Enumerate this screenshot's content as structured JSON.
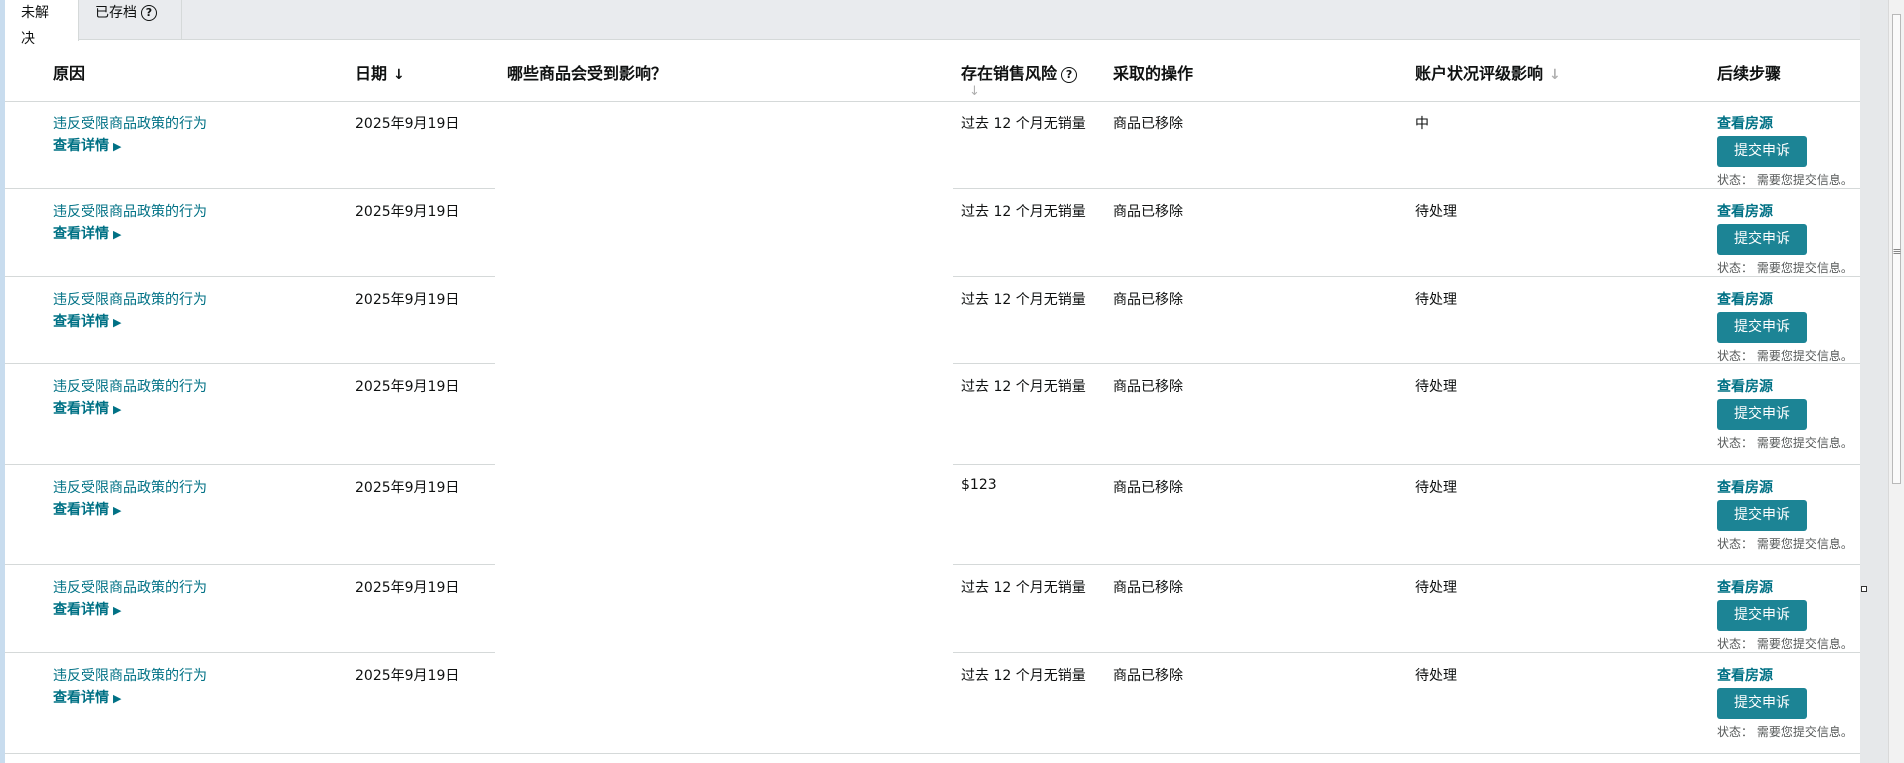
{
  "tabs": {
    "unresolved": "未解决",
    "archived": "已存档"
  },
  "columns": {
    "reason": "原因",
    "date": "日期",
    "affected": "哪些商品会受到影响？",
    "risk": "存在销售风险",
    "action": "采取的操作",
    "impact": "账户状况评级影响",
    "next": "后续步骤"
  },
  "icons": {
    "sort_down": "↓",
    "triangle": "▶",
    "help": "?"
  },
  "labels": {
    "view_details": "查看详情",
    "view_source": "查看房源",
    "submit_appeal": "提交申诉",
    "status": "状态： 需要您提交信息。"
  },
  "rows": [
    {
      "reason": "违反受限商品政策的行为",
      "date": "2025年9月19日",
      "risk": "过去 12 个月无销量",
      "action": "商品已移除",
      "impact": "中"
    },
    {
      "reason": "违反受限商品政策的行为",
      "date": "2025年9月19日",
      "risk": "过去 12 个月无销量",
      "action": "商品已移除",
      "impact": "待处理"
    },
    {
      "reason": "违反受限商品政策的行为",
      "date": "2025年9月19日",
      "risk": "过去 12 个月无销量",
      "action": "商品已移除",
      "impact": "待处理"
    },
    {
      "reason": "违反受限商品政策的行为",
      "date": "2025年9月19日",
      "risk": "过去 12 个月无销量",
      "action": "商品已移除",
      "impact": "待处理"
    },
    {
      "reason": "违反受限商品政策的行为",
      "date": "2025年9月19日",
      "risk": "$123",
      "action": "商品已移除",
      "impact": "待处理"
    },
    {
      "reason": "违反受限商品政策的行为",
      "date": "2025年9月19日",
      "risk": "过去 12 个月无销量",
      "action": "商品已移除",
      "impact": "待处理"
    },
    {
      "reason": "违反受限商品政策的行为",
      "date": "2025年9月19日",
      "risk": "过去 12 个月无销量",
      "action": "商品已移除",
      "impact": "待处理"
    }
  ]
}
